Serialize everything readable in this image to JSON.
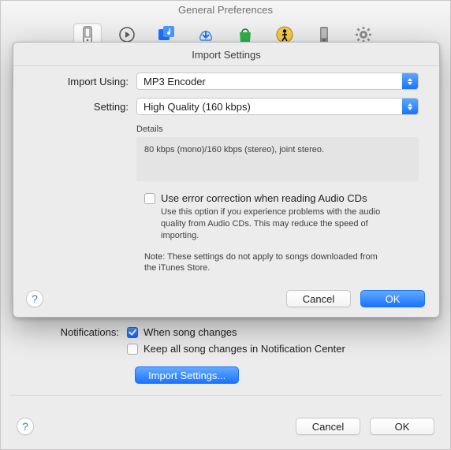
{
  "window": {
    "title": "General Preferences"
  },
  "sheet": {
    "title": "Import Settings",
    "importUsing": {
      "label": "Import Using:",
      "value": "MP3 Encoder"
    },
    "setting": {
      "label": "Setting:",
      "value": "High Quality (160 kbps)"
    },
    "details": {
      "label": "Details",
      "text": "80 kbps (mono)/160 kbps (stereo), joint stereo."
    },
    "errorCorrection": {
      "label": "Use error correction when reading Audio CDs",
      "hint": "Use this option if you experience problems with the audio quality from Audio CDs.  This may reduce the speed of importing.",
      "checked": false
    },
    "note": "Note: These settings do not apply to songs downloaded from the iTunes Store.",
    "buttons": {
      "cancel": "Cancel",
      "ok": "OK"
    }
  },
  "back": {
    "notifications": {
      "label": "Notifications:",
      "whenSongChanges": {
        "label": "When song changes",
        "checked": true
      },
      "keepAll": {
        "label": "Keep all song changes in Notification Center",
        "checked": false
      }
    },
    "importSettingsButton": "Import Settings...",
    "buttons": {
      "cancel": "Cancel",
      "ok": "OK"
    }
  },
  "helpGlyph": "?",
  "toolbarIcons": [
    "device",
    "play",
    "music",
    "download",
    "store",
    "parental",
    "phone",
    "gear"
  ]
}
